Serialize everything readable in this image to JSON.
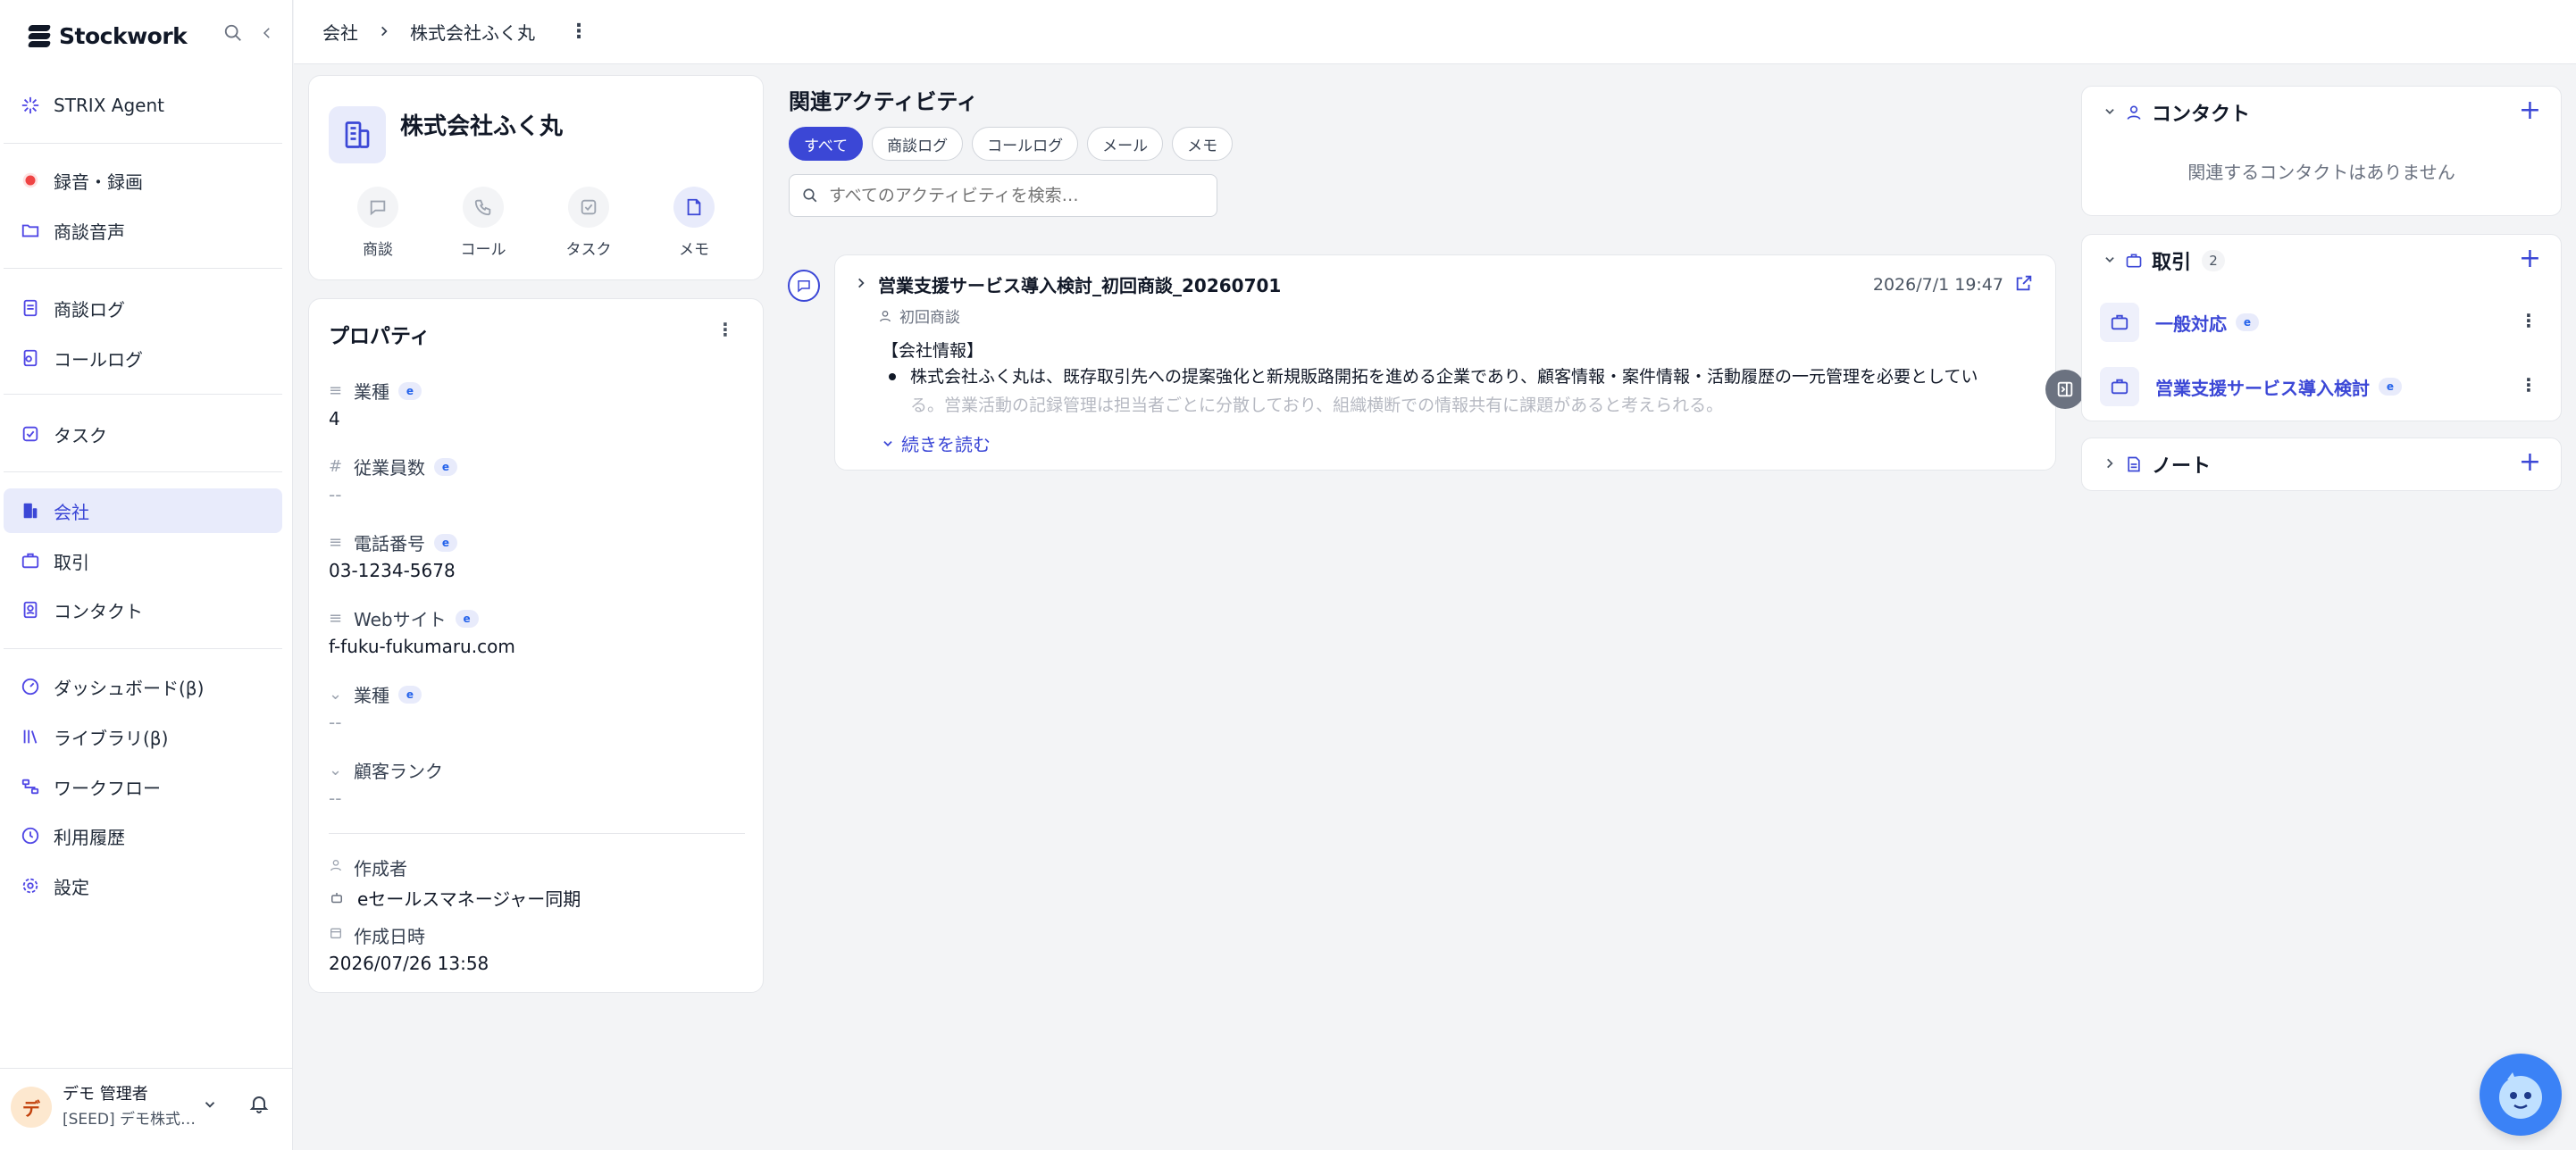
{
  "app": {
    "brand": "Stockwork"
  },
  "sidebar": {
    "items": [
      {
        "label": "STRIX Agent"
      },
      {
        "label": "録音・録画"
      },
      {
        "label": "商談音声"
      },
      {
        "label": "商談ログ"
      },
      {
        "label": "コールログ"
      },
      {
        "label": "タスク"
      },
      {
        "label": "会社"
      },
      {
        "label": "取引"
      },
      {
        "label": "コンタクト"
      },
      {
        "label": "ダッシュボード(β)"
      },
      {
        "label": "ライブラリ(β)"
      },
      {
        "label": "ワークフロー"
      },
      {
        "label": "利用履歴"
      },
      {
        "label": "設定"
      }
    ],
    "active_index": 6,
    "user": {
      "initial": "デ",
      "name": "デモ 管理者",
      "org": "[SEED] デモ株式…"
    }
  },
  "header": {
    "breadcrumb": [
      "会社",
      "株式会社ふく丸"
    ]
  },
  "company": {
    "name": "株式会社ふく丸",
    "actions": [
      {
        "label": "商談"
      },
      {
        "label": "コール"
      },
      {
        "label": "タスク"
      },
      {
        "label": "メモ"
      }
    ]
  },
  "properties": {
    "title": "プロパティ",
    "fields": [
      {
        "label": "業種",
        "value": "4"
      },
      {
        "label": "従業員数",
        "value": "--"
      },
      {
        "label": "電話番号",
        "value": "03-1234-5678"
      },
      {
        "label": "Webサイト",
        "value": "f-fuku-fukumaru.com"
      },
      {
        "label": "業種",
        "value": "--"
      },
      {
        "label": "顧客ランク",
        "value": "--"
      }
    ],
    "created_by_label": "作成者",
    "created_by": "eセールスマネージャー同期",
    "created_at_label": "作成日時",
    "created_at": "2026/07/26 13:58"
  },
  "activity": {
    "title": "関連アクティビティ",
    "filters": [
      "すべて",
      "商談ログ",
      "コールログ",
      "メール",
      "メモ"
    ],
    "search_placeholder": "すべてのアクティビティを検索…",
    "item": {
      "title": "営業支援サービス導入検討_初回商談_20260701",
      "subtitle": "初回商談",
      "date": "2026/7/1 19:47",
      "heading": "【会社情報】",
      "line1": "株式会社ふく丸は、既存取引先への提案強化と新規販路開拓を進める企業であり、顧客情報・案件情報・活動履歴の一元管理を必要としてい",
      "line2": "る。営業活動の記録管理は担当者ごとに分散しており、組織横断での情報共有に課題があると考えられる。",
      "read_more": "続きを読む"
    }
  },
  "contacts": {
    "title": "コンタクト",
    "empty": "関連するコンタクトはありません"
  },
  "deals": {
    "title": "取引",
    "count": "2",
    "items": [
      {
        "name": "一般対応"
      },
      {
        "name": "営業支援サービス導入検討"
      }
    ]
  },
  "notes": {
    "title": "ノート"
  },
  "colors": {
    "accent": "#3b47d6",
    "active_bg": "#e8ebfb"
  }
}
